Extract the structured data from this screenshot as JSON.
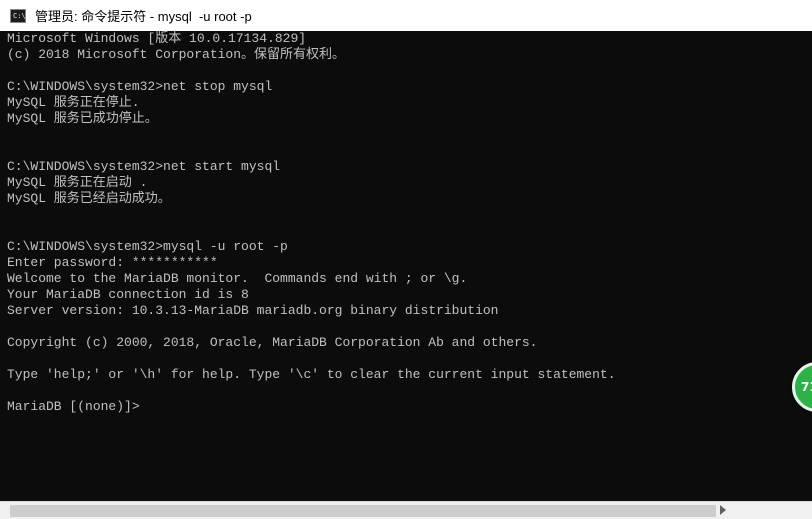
{
  "window": {
    "title": "管理员: 命令提示符 - mysql  -u root -p",
    "icon": "C:\\"
  },
  "console": {
    "lines": [
      "Microsoft Windows [版本 10.0.17134.829]",
      "(c) 2018 Microsoft Corporation。保留所有权利。",
      "",
      "C:\\WINDOWS\\system32>net stop mysql",
      "MySQL 服务正在停止.",
      "MySQL 服务已成功停止。",
      "",
      "",
      "C:\\WINDOWS\\system32>net start mysql",
      "MySQL 服务正在启动 .",
      "MySQL 服务已经启动成功。",
      "",
      "",
      "C:\\WINDOWS\\system32>mysql -u root -p",
      "Enter password: ***********",
      "Welcome to the MariaDB monitor.  Commands end with ; or \\g.",
      "Your MariaDB connection id is 8",
      "Server version: 10.3.13-MariaDB mariadb.org binary distribution",
      "",
      "Copyright (c) 2000, 2018, Oracle, MariaDB Corporation Ab and others.",
      "",
      "Type 'help;' or '\\h' for help. Type '\\c' to clear the current input statement.",
      "",
      "MariaDB [(none)]>"
    ]
  },
  "floating_widget": {
    "label": "71"
  },
  "colors": {
    "console_bg": "#0c0c0c",
    "console_text": "#c0c0c0",
    "widget": "#2fb14a"
  }
}
